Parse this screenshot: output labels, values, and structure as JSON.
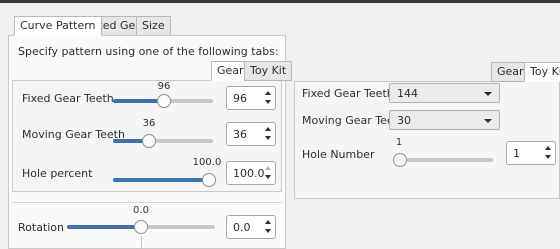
{
  "tabs": [
    {
      "label": "Curve Pattern",
      "active": true
    },
    {
      "label": "Fixed Gear",
      "active": false
    },
    {
      "label": "Size",
      "active": false
    }
  ],
  "instruction": "Specify pattern using one of the following tabs:",
  "left_subtabs": [
    {
      "label": "Gears",
      "active": true
    },
    {
      "label": "Toy Kit",
      "active": false
    }
  ],
  "fixed_gear_teeth": {
    "label": "Fixed Gear Teeth",
    "slider_value": "96",
    "value": "96",
    "fraction": 0.52
  },
  "moving_gear_teeth": {
    "label": "Moving Gear Teeth",
    "slider_value": "36",
    "value": "36",
    "fraction": 0.37
  },
  "hole_percent": {
    "label": "Hole percent",
    "slider_value": "100.0",
    "value": "100.0",
    "fraction": 1.0
  },
  "rotation": {
    "label": "Rotation",
    "slider_value": "0.0",
    "value": "0.0",
    "fraction": 0.5
  },
  "right_subtabs": [
    {
      "label": "Gears",
      "active": false
    },
    {
      "label": "Toy Kit",
      "active": true
    }
  ],
  "toykit": {
    "fixed_gear_teeth": {
      "label": "Fixed Gear Teeth",
      "value": "144"
    },
    "moving_gear_teeth": {
      "label": "Moving Gear Teeth",
      "value": "30"
    },
    "hole_number": {
      "label": "Hole Number",
      "slider_value": "1",
      "value": "1",
      "fraction": 0.0
    }
  },
  "colors": {
    "accent": "#3f6fb5",
    "background": "#f0f0f0"
  }
}
